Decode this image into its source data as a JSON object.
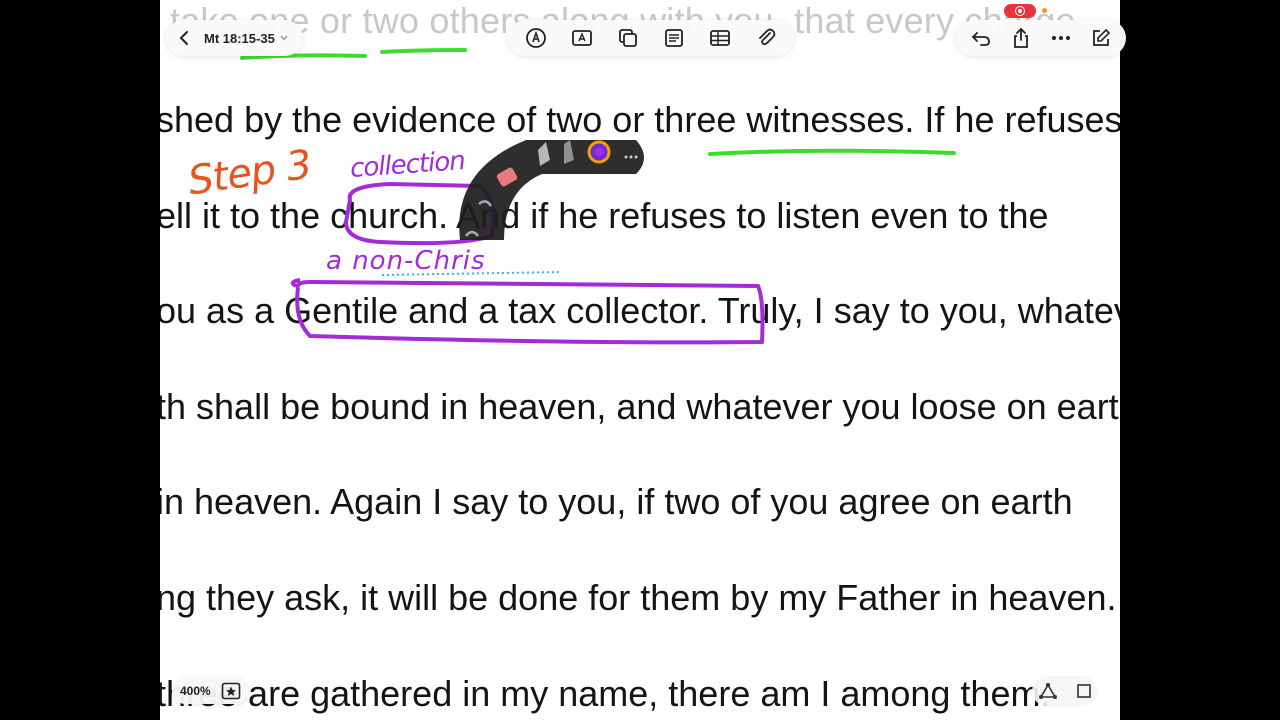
{
  "toolbar": {
    "back_icon": "chevron-left-icon",
    "document_title": "Mt 18:15-35",
    "tools": [
      "pen-tool-icon",
      "text-box-icon",
      "pages-icon",
      "document-icon",
      "table-icon",
      "paperclip-icon"
    ],
    "right_actions": [
      "undo-icon",
      "share-icon",
      "more-icon",
      "edit-icon"
    ]
  },
  "document": {
    "faded_line": "take one or two others along with you, that every charge",
    "lines": [
      "shed by the evidence of two or three witnesses. If he refuses",
      "ell it to the church. And if he refuses to listen even to the",
      "ou as a Gentile and a tax collector. Truly, I say to you, whatever",
      "th shall be bound in heaven, and whatever you loose on earth",
      " in heaven. Again I say to you, if two of you agree on earth",
      "ng they ask, it will be done for them by my Father in heaven.",
      "three are gathered in my name, there am I among them."
    ]
  },
  "annotations": {
    "step_label": "Step 3",
    "collection_note": "collection",
    "non_christian_note": "a non-Chris",
    "colors": {
      "orange": "#e8541e",
      "purple": "#a32bd8",
      "green": "#3ddc2c"
    }
  },
  "bottom": {
    "zoom_label": "400%"
  }
}
